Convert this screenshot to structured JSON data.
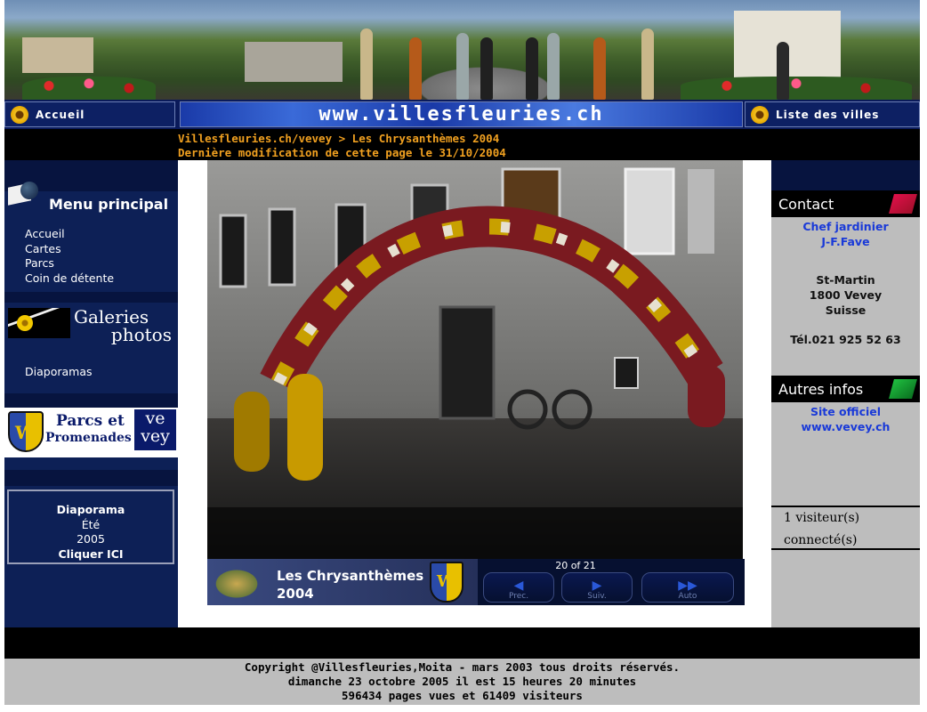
{
  "nav": {
    "home_label": "Accueil",
    "site_url": "www.villesfleuries.ch",
    "cities_label": "Liste des villes"
  },
  "breadcrumb": {
    "path": "Villesfleuries.ch/vevey > Les Chrysanthèmes 2004",
    "last_modified": "Dernière modification de cette page le 31/10/2004"
  },
  "sidebar": {
    "main_menu_title": "Menu principal",
    "main_menu_items": [
      "Accueil",
      "Cartes",
      "Parcs",
      "Coin de détente"
    ],
    "gallery_title_line1": "Galeries",
    "gallery_title_line2": "photos",
    "gallery_items": [
      "Diaporamas"
    ],
    "parks_logo": {
      "line1": "Parcs et",
      "line2": "Promenades",
      "city1": "ve",
      "city2": "vey"
    },
    "slideshow_box": {
      "line1": "Diaporama",
      "line2": "Été",
      "line3": "2005",
      "line4": "Cliquer ICI"
    }
  },
  "viewer": {
    "caption_line1": "Les Chrysanthèmes",
    "caption_line2": "2004",
    "counter": "20 of 21",
    "prev_label": "Prec.",
    "next_label": "Suiv.",
    "auto_label": "Auto"
  },
  "contact": {
    "title": "Contact",
    "gardener_title": "Chef jardinier",
    "gardener_name": "J-F.Fave",
    "address_line1": "St-Martin",
    "address_line2": "1800 Vevey",
    "address_line3": "Suisse",
    "phone": "Tél.021 925 52 63"
  },
  "other_info": {
    "title": "Autres infos",
    "official_site": "Site officiel",
    "official_url": "www.vevey.ch"
  },
  "visitors": {
    "line1": "1 visiteur(s)",
    "line2": "connecté(s)"
  },
  "footer": {
    "copyright": "Copyright @Villesfleuries,Moita - mars 2003 tous droits réservés.",
    "datetime": "dimanche 23 octobre 2005 il est 15 heures 20 minutes",
    "stats": "596434 pages vues et 61409 visiteurs"
  },
  "colors": {
    "accent_orange": "#f0a020",
    "nav_blue": "#0d2056",
    "link_blue": "#1a3ad8"
  }
}
